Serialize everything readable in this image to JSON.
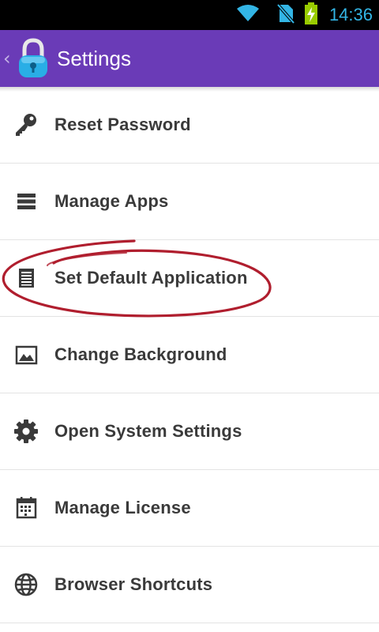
{
  "status_bar": {
    "time": "14:36",
    "icons": [
      "wifi-icon",
      "no-sim-icon",
      "battery-charging-icon"
    ],
    "time_color": "#33b5e5"
  },
  "action_bar": {
    "title": "Settings",
    "icon": "padlock-icon",
    "background": "#6a3bb7"
  },
  "menu": {
    "items": [
      {
        "label": "Reset Password",
        "icon": "key-icon"
      },
      {
        "label": "Manage Apps",
        "icon": "list-icon"
      },
      {
        "label": "Set Default Application",
        "icon": "document-icon"
      },
      {
        "label": "Change Background",
        "icon": "image-icon"
      },
      {
        "label": "Open System Settings",
        "icon": "gear-icon"
      },
      {
        "label": "Manage License",
        "icon": "calendar-icon"
      },
      {
        "label": "Browser Shortcuts",
        "icon": "globe-icon"
      }
    ]
  },
  "annotation": {
    "type": "hand-drawn-ellipse",
    "color": "#b01e2e",
    "target": "Set Default Application"
  }
}
